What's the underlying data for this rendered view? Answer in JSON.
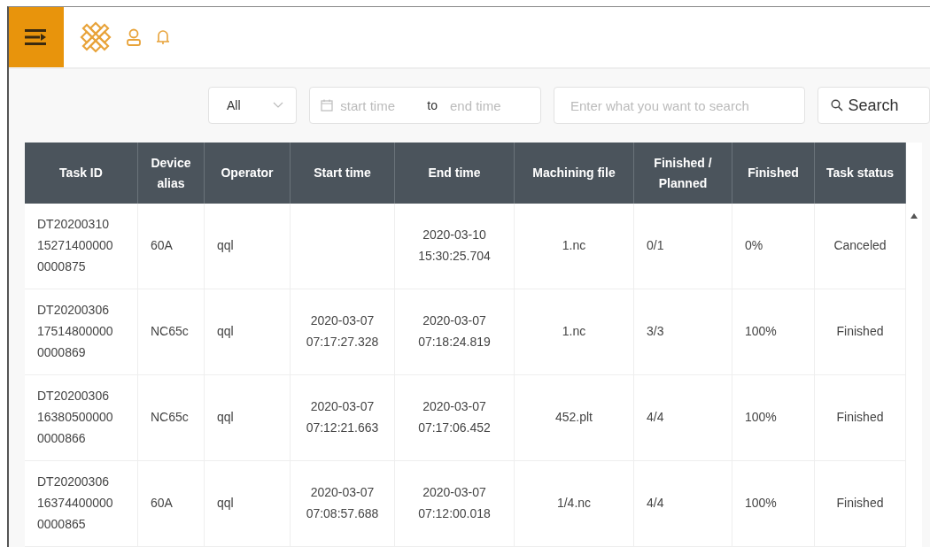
{
  "filters": {
    "type_select": {
      "value": "All"
    },
    "date_range": {
      "start_placeholder": "start time",
      "separator": "to",
      "end_placeholder": "end time"
    },
    "search": {
      "placeholder": "Enter what you want to search"
    },
    "search_button": "Search"
  },
  "table": {
    "columns": [
      {
        "label": "Task ID"
      },
      {
        "label": "Device alias"
      },
      {
        "label": "Operator"
      },
      {
        "label": "Start time"
      },
      {
        "label": "End time"
      },
      {
        "label": "Machining file"
      },
      {
        "label": "Finished / Planned"
      },
      {
        "label": "Finished"
      },
      {
        "label": "Task status"
      }
    ],
    "rows": [
      [
        "DT20200310152714000000000875",
        "60A",
        "qql",
        "",
        "2020-03-10 15:30:25.704",
        "1.nc",
        "0/1",
        "0%",
        "Canceled"
      ],
      [
        "DT20200306175148000000000869",
        "NC65c",
        "qql",
        "2020-03-07 07:17:27.328",
        "2020-03-07 07:18:24.819",
        "1.nc",
        "3/3",
        "100%",
        "Finished"
      ],
      [
        "DT20200306163805000000000866",
        "NC65c",
        "qql",
        "2020-03-07 07:12:21.663",
        "2020-03-07 07:17:06.452",
        "452.plt",
        "4/4",
        "100%",
        "Finished"
      ],
      [
        "DT20200306163744000000000865",
        "60A",
        "qql",
        "2020-03-07 07:08:57.688",
        "2020-03-07 07:12:00.018",
        "1/4.nc",
        "4/4",
        "100%",
        "Finished"
      ]
    ]
  }
}
